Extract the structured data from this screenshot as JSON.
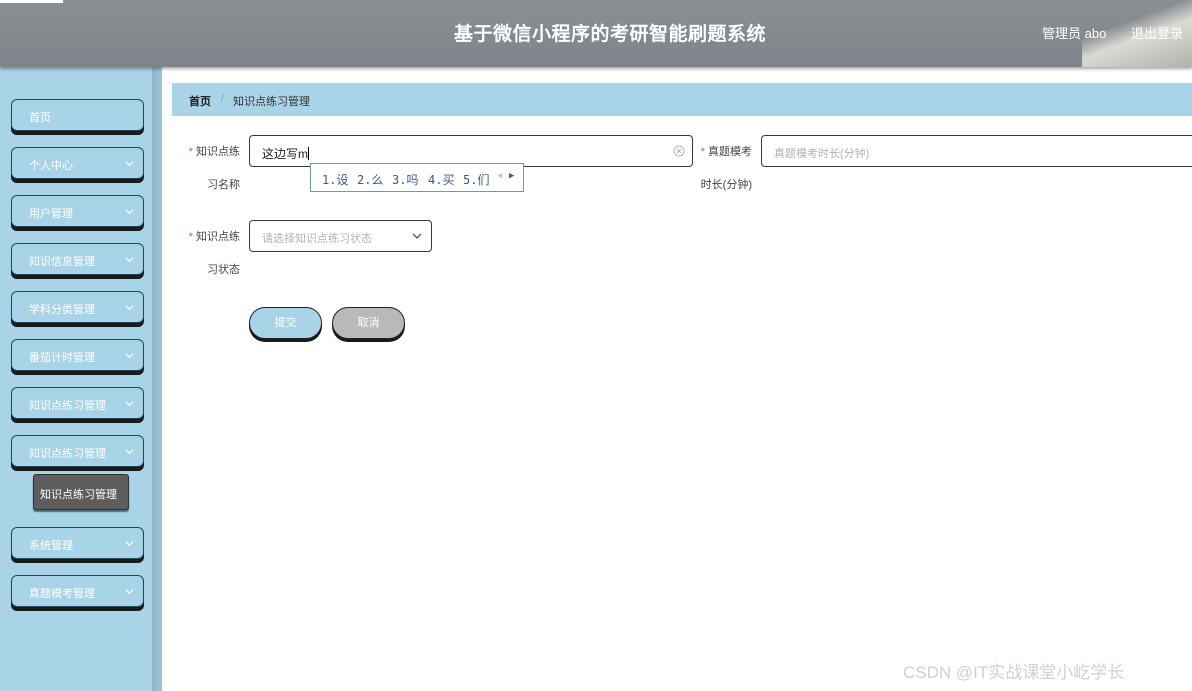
{
  "header": {
    "title": "基于微信小程序的考研智能刷题系统",
    "admin_label": "管理员 abo",
    "logout_label": "退出登录"
  },
  "sidebar": {
    "items": [
      {
        "label": "首页",
        "has_arrow": false
      },
      {
        "label": "个人中心",
        "has_arrow": true
      },
      {
        "label": "用户管理",
        "has_arrow": true
      },
      {
        "label": "知识信息管理",
        "has_arrow": true
      },
      {
        "label": "学科分类管理",
        "has_arrow": true
      },
      {
        "label": "番茄计时管理",
        "has_arrow": true
      },
      {
        "label": "知识点练习管理",
        "has_arrow": true
      },
      {
        "label": "知识点练习管理",
        "has_arrow": true
      },
      {
        "label": "系统管理",
        "has_arrow": true
      },
      {
        "label": "真题模考管理",
        "has_arrow": true
      }
    ],
    "subitem": {
      "label": "知识点练习管理"
    }
  },
  "breadcrumb": {
    "home": "首页",
    "separator": "/",
    "current": "知识点练习管理"
  },
  "form": {
    "name_label_line1": "知识点练",
    "name_label_line2": "习名称",
    "name_value": "这边写m",
    "exam_label_line1": "真题模考",
    "exam_label_line2": "时长(分钟)",
    "exam_placeholder": "真题模考时长(分钟)",
    "status_label_line1": "知识点练",
    "status_label_line2": "习状态",
    "status_placeholder": "请选择知识点练习状态",
    "required_mark": "*"
  },
  "ime": {
    "candidates": [
      "1.设",
      "2.么",
      "3.吗",
      "4.买",
      "5.们"
    ]
  },
  "buttons": {
    "submit": "提交",
    "cancel": "取消"
  },
  "watermark": "CSDN @IT实战课堂小屹学长",
  "colors": {
    "header_bg": "#8a8f93",
    "sidebar_bg": "#a9d3e6",
    "submenu_bg": "#5d5d5d",
    "submit_bg": "#a9d3e6",
    "cancel_bg": "#b9b9b9",
    "required": "#e0564f"
  }
}
